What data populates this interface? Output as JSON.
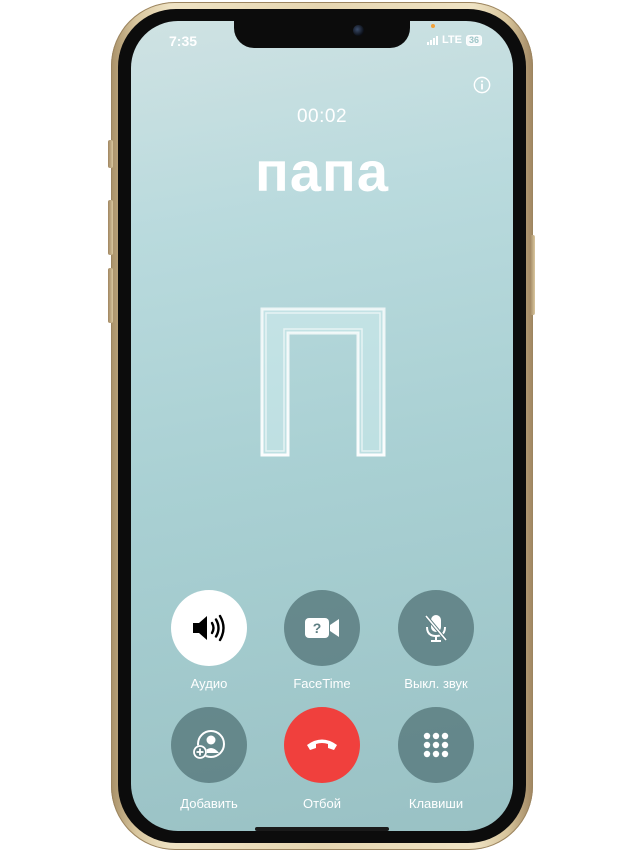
{
  "status_bar": {
    "time": "7:35",
    "network": "LTE",
    "battery": "36"
  },
  "call": {
    "duration": "00:02",
    "caller_name": "папа",
    "monogram": "П"
  },
  "controls": {
    "audio": "Аудио",
    "facetime": "FaceTime",
    "mute": "Выкл. звук",
    "add": "Добавить",
    "end": "Отбой",
    "keypad": "Клавиши"
  },
  "colors": {
    "end_call": "#f0403d",
    "button_bg": "#54767a",
    "screen_bg": "#a9d0d3"
  },
  "icons": {
    "audio": "speaker-icon",
    "facetime": "video-icon",
    "mute": "microphone-slash-icon",
    "add": "add-person-icon",
    "end": "phone-hangup-icon",
    "keypad": "keypad-icon",
    "info": "info-icon"
  }
}
